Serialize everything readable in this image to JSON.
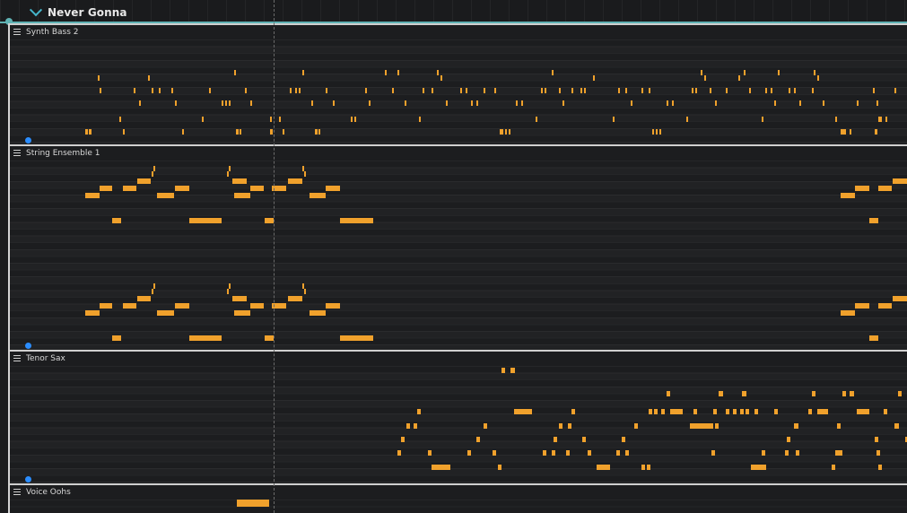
{
  "header": {
    "title": "Never Gonna"
  },
  "tracks": [
    {
      "name": "Synth Bass 2"
    },
    {
      "name": "String Ensemble 1"
    },
    {
      "name": "Tenor Sax"
    },
    {
      "name": "Voice Oohs"
    }
  ],
  "colors": {
    "note": "#f0a12c",
    "accent": "#5fb2b4",
    "record_dot": "#2b8dff"
  }
}
